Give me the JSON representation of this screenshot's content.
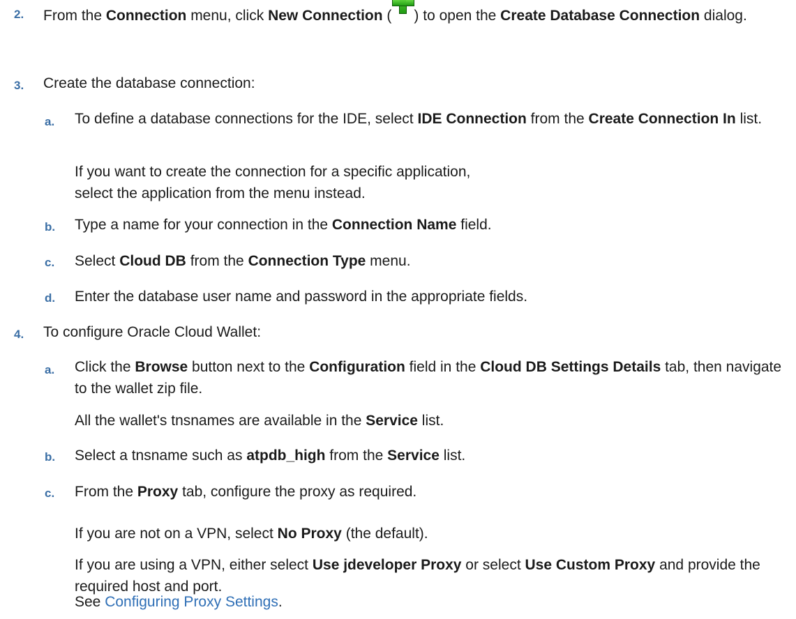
{
  "steps": [
    {
      "num": "2.",
      "parts": {
        "t1": "From the ",
        "b1": "Connection",
        "t2": " menu, click ",
        "b2": "New Connection",
        "t3": " (",
        "t4": ") to open the ",
        "b3": "Create Database Connection",
        "t5": " dialog."
      },
      "icon": "plus-icon"
    },
    {
      "num": "3.",
      "text": "Create the database connection:",
      "substeps": [
        {
          "letter": "a.",
          "t1": "To define a database connections for the IDE, select ",
          "b1": "IDE Connection",
          "t2": " from the ",
          "b2": "Create Connection In",
          "t3": " list.",
          "note": "If you want to create the connection for a specific application, select the application from the menu instead."
        },
        {
          "letter": "b.",
          "t1": "Type a name for your connection in the ",
          "b1": "Connection Name",
          "t2": " field."
        },
        {
          "letter": "c.",
          "t1": "Select ",
          "b1": "Cloud DB",
          "t2": " from the ",
          "b2": "Connection Type",
          "t3": " menu."
        },
        {
          "letter": "d.",
          "t1": "Enter the database user name and password in the appropriate fields."
        }
      ]
    },
    {
      "num": "4.",
      "text": "To configure Oracle Cloud Wallet:",
      "substeps": [
        {
          "letter": "a.",
          "t1": "Click the ",
          "b1": "Browse",
          "t2": " button next to the ",
          "b2": "Configuration",
          "t3": " field in the ",
          "b3": "Cloud DB Settings Details",
          "t4": " tab, then navigate to the wallet zip file.",
          "note_t1": "All the wallet's tnsnames are available in the ",
          "note_b1": "Service",
          "note_t2": " list."
        },
        {
          "letter": "b.",
          "t1": "Select a tnsname such as ",
          "b1": "atpdb_high",
          "t2": " from the ",
          "b2": "Service",
          "t3": " list."
        },
        {
          "letter": "c.",
          "t1": "From the ",
          "b1": "Proxy",
          "t2": " tab, configure the proxy as required.",
          "note1_t1": "If you are not on a VPN, select ",
          "note1_b1": "No Proxy",
          "note1_t2": " (the default).",
          "note2_t1": "If you are using a VPN, either select ",
          "note2_b1": "Use jdeveloper Proxy",
          "note2_t2": " or select ",
          "note2_b2": "Use Custom Proxy",
          "note2_t3": " and provide the required host and port.",
          "see_t1": "See ",
          "see_link": "Configuring Proxy Settings",
          "see_t2": "."
        }
      ]
    }
  ]
}
